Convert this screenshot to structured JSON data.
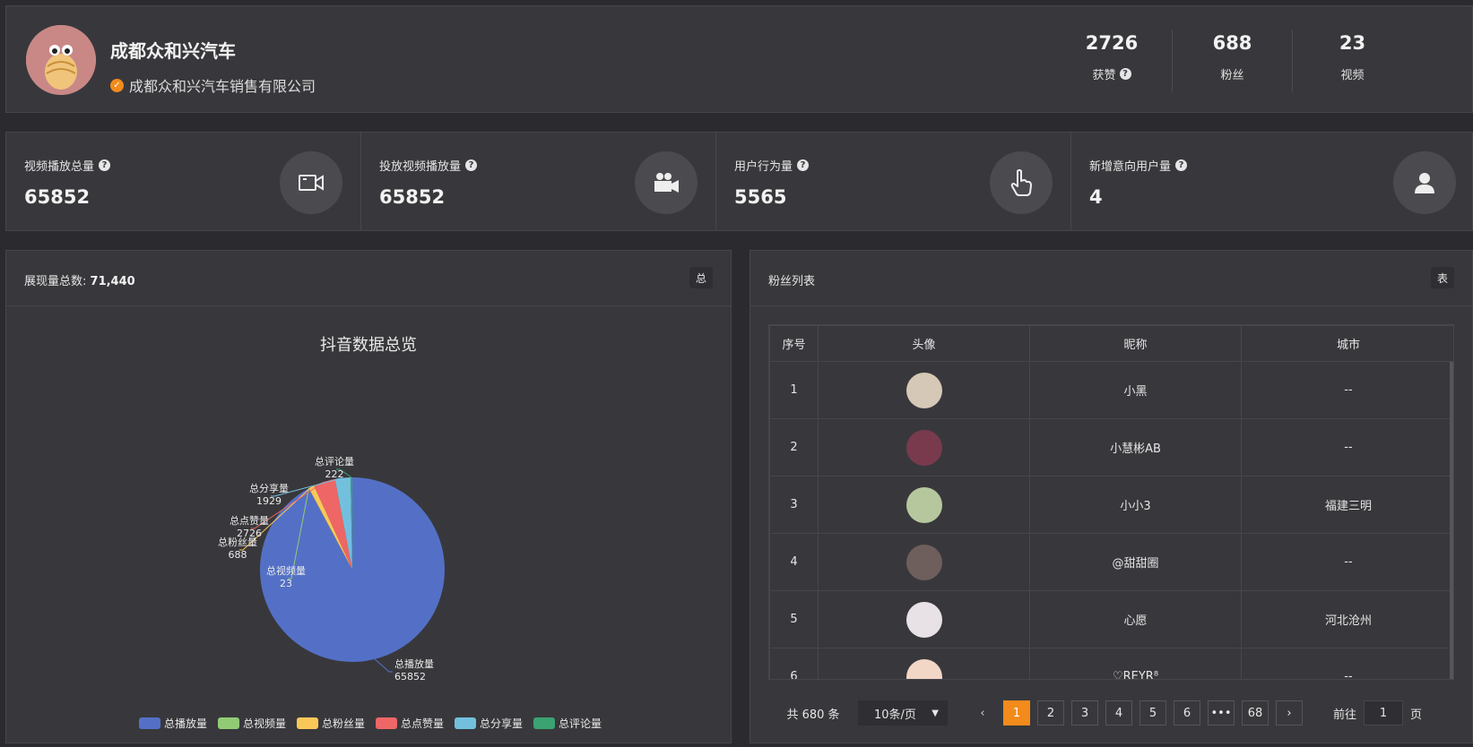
{
  "header": {
    "shop_name": "成都众和兴汽车",
    "company": "成都众和兴汽车销售有限公司",
    "stats": [
      {
        "value": "2726",
        "label": "获赞"
      },
      {
        "value": "688",
        "label": "粉丝"
      },
      {
        "value": "23",
        "label": "视频"
      }
    ]
  },
  "metrics": [
    {
      "label": "视频播放总量",
      "value": "65852",
      "icon": "video-icon"
    },
    {
      "label": "投放视频播放量",
      "value": "65852",
      "icon": "movie-camera-icon"
    },
    {
      "label": "用户行为量",
      "value": "5565",
      "icon": "hand-pointer-icon"
    },
    {
      "label": "新增意向用户量",
      "value": "4",
      "icon": "user-icon"
    }
  ],
  "chart_panel": {
    "title_label": "展现量总数:",
    "title_value": "71,440",
    "tag": "总"
  },
  "fans_panel": {
    "title": "粉丝列表",
    "tag": "表",
    "columns": [
      "序号",
      "头像",
      "昵称",
      "城市"
    ],
    "rows": [
      {
        "idx": "1",
        "nickname": "小黑",
        "city": "--",
        "avatar_color": "#d6c8b6"
      },
      {
        "idx": "2",
        "nickname": "小慧彬AB",
        "city": "--",
        "avatar_color": "#7a3a4e"
      },
      {
        "idx": "3",
        "nickname": "小小3",
        "city": "福建三明",
        "avatar_color": "#b6c79e"
      },
      {
        "idx": "4",
        "nickname": "@甜甜圈",
        "city": "--",
        "avatar_color": "#6e5e5c"
      },
      {
        "idx": "5",
        "nickname": "心愿",
        "city": "河北沧州",
        "avatar_color": "#e8e2e6"
      },
      {
        "idx": "6",
        "nickname": "♡REYR⁸",
        "city": "--",
        "avatar_color": "#f2d6c6"
      }
    ],
    "pager": {
      "total": "共 680 条",
      "page_size": "10条/页",
      "pages": [
        "1",
        "2",
        "3",
        "4",
        "5",
        "6",
        "•••",
        "68"
      ],
      "active_page": "1",
      "goto_label": "前往",
      "goto_value": "1",
      "goto_unit": "页"
    }
  },
  "chart_data": {
    "type": "pie",
    "title": "抖音数据总览",
    "slices": [
      {
        "name": "总播放量",
        "value": 65852,
        "color": "#5470c6"
      },
      {
        "name": "总视频量",
        "value": 23,
        "color": "#91cc75"
      },
      {
        "name": "总粉丝量",
        "value": 688,
        "color": "#fac858"
      },
      {
        "name": "总点赞量",
        "value": 2726,
        "color": "#ee6666"
      },
      {
        "name": "总分享量",
        "value": 1929,
        "color": "#73c0de"
      },
      {
        "name": "总评论量",
        "value": 222,
        "color": "#3ba272"
      }
    ],
    "legend_position": "bottom"
  },
  "colors": {
    "accent": "#f28b1c",
    "panel": "#38383c",
    "background": "#2b2b2f"
  }
}
